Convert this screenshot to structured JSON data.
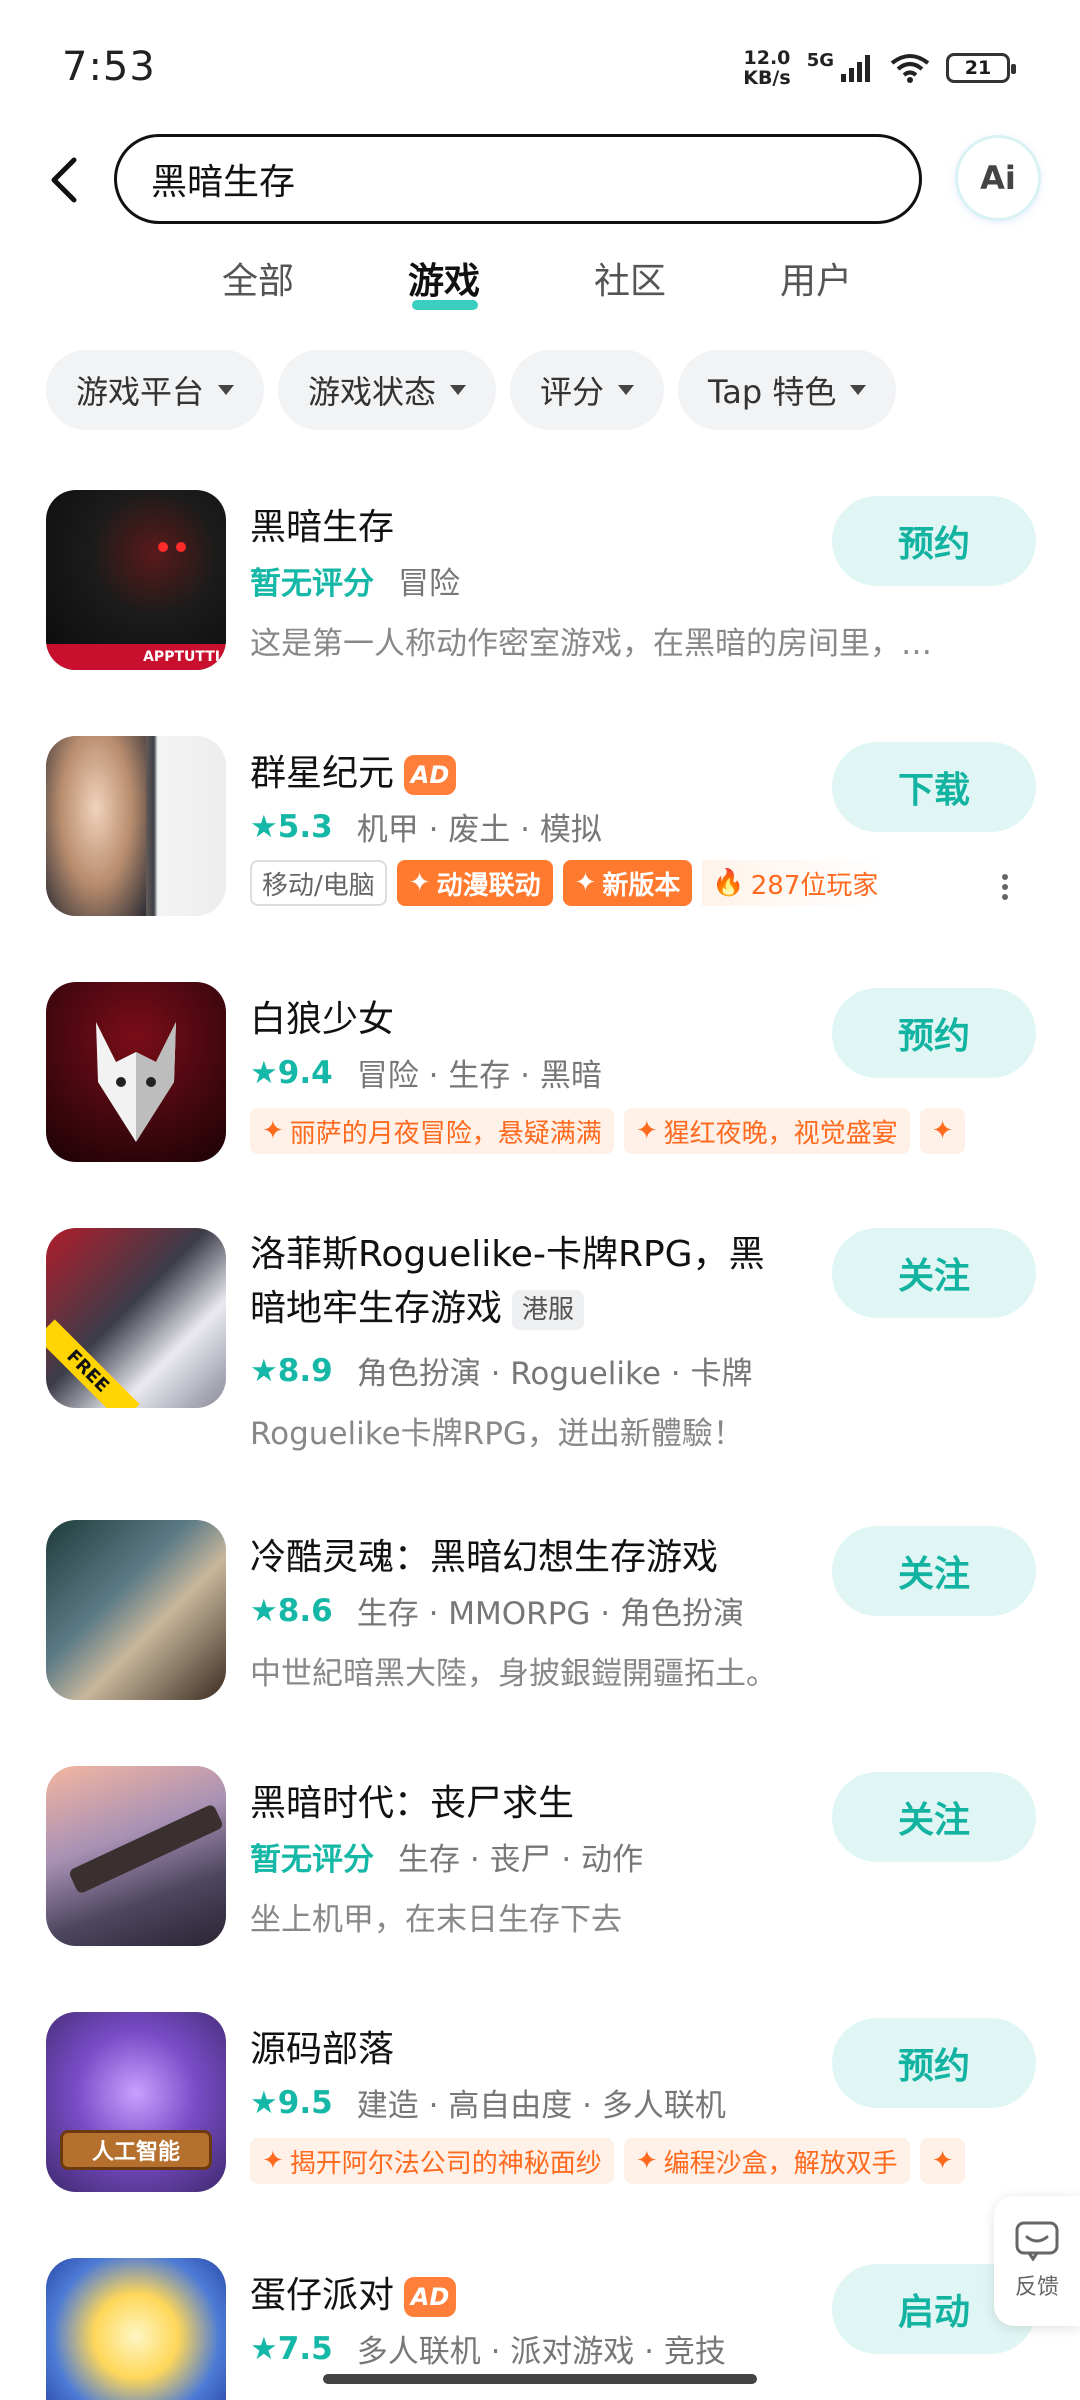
{
  "status": {
    "time": "7:53",
    "speed_top": "12.0",
    "speed_bottom": "KB/s",
    "network": "5G",
    "battery": "21"
  },
  "search": {
    "query": "黑暗生存",
    "ai_label": "Ai"
  },
  "tabs": [
    {
      "label": "全部",
      "active": false
    },
    {
      "label": "游戏",
      "active": true
    },
    {
      "label": "社区",
      "active": false
    },
    {
      "label": "用户",
      "active": false
    }
  ],
  "filters": [
    {
      "label": "游戏平台"
    },
    {
      "label": "游戏状态"
    },
    {
      "label": "评分"
    },
    {
      "label": "Tap 特色"
    }
  ],
  "colors": {
    "accent": "#15b8a6",
    "action_bg": "#e0f6f4",
    "ad": "#ff7e3a",
    "tag_orange": "#ff7a2e"
  },
  "games": [
    {
      "title": "黑暗生存",
      "rating": "暂无评分",
      "genres": "冒险",
      "desc": "这是第一人称动作密室游戏，在黑暗的房间里，…",
      "action": "预约",
      "icon_badge": "APPTUTTI"
    },
    {
      "title": "群星纪元",
      "ad": "AD",
      "rating": "5.3",
      "genres": "机甲 · 废土 · 模拟",
      "tags": {
        "platform": "移动/电脑",
        "t1": "动漫联动",
        "t2": "新版本",
        "players": "287位玩家"
      },
      "action": "下载"
    },
    {
      "title": "白狼少女",
      "rating": "9.4",
      "genres": "冒险 · 生存 · 黑暗",
      "tags": {
        "s1": "丽萨的月夜冒险，悬疑满满",
        "s2": "猩红夜晚，视觉盛宴"
      },
      "action": "预约"
    },
    {
      "title_line1": "洛菲斯Roguelike-卡牌RPG，黑",
      "title_line2": "暗地牢生存游戏",
      "region": "港服",
      "rating": "8.9",
      "genres": "角色扮演 · Roguelike · 卡牌",
      "desc": "Roguelike卡牌RPG，迸出新體驗！",
      "action": "关注",
      "icon_badge": "FREE"
    },
    {
      "title": "冷酷灵魂：黑暗幻想生存游戏",
      "rating": "8.6",
      "genres": "生存 · MMORPG · 角色扮演",
      "desc": "中世紀暗黑大陸，身披銀鎧開疆拓土。",
      "action": "关注"
    },
    {
      "title": "黑暗时代：丧尸求生",
      "rating": "暂无评分",
      "genres": "生存 · 丧尸 · 动作",
      "desc": "坐上机甲，在末日生存下去",
      "action": "关注"
    },
    {
      "title": "源码部落",
      "rating": "9.5",
      "genres": "建造 · 高自由度 · 多人联机",
      "tags": {
        "s1": "揭开阿尔法公司的神秘面纱",
        "s2": "编程沙盒，解放双手"
      },
      "action": "预约",
      "icon_badge": "人工智能"
    },
    {
      "title": "蛋仔派对",
      "ad": "AD",
      "rating": "7.5",
      "genres": "多人联机 · 派对游戏 · 竞技",
      "action": "启动"
    }
  ],
  "feedback": {
    "label": "反馈"
  }
}
